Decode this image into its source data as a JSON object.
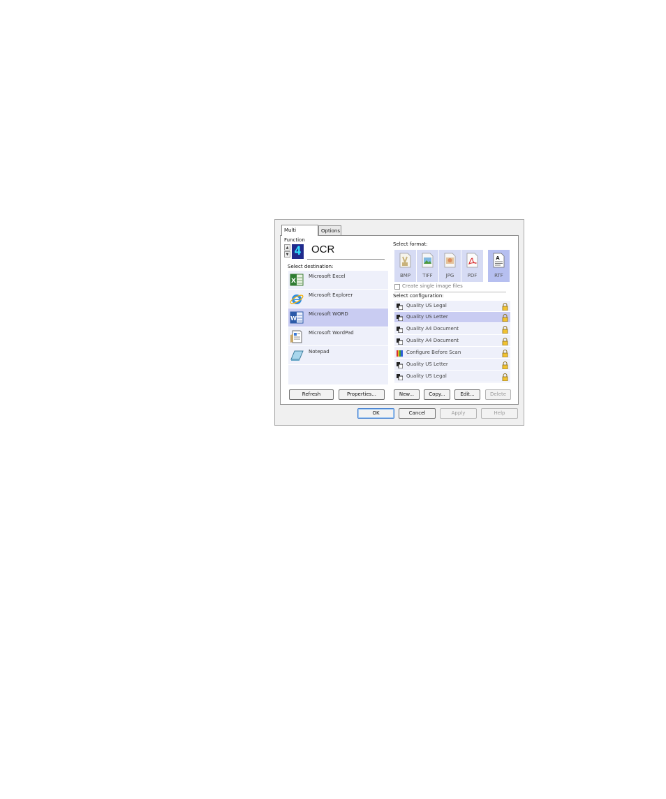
{
  "dialog": {
    "tabs": [
      {
        "label": "Multi Function",
        "active": true
      },
      {
        "label": "Options",
        "active": false
      }
    ],
    "profile": {
      "number": "4",
      "title": "OCR"
    },
    "labels": {
      "select_destination": "Select destination:",
      "select_format": "Select format:",
      "create_single": "Create single image files",
      "select_configuration": "Select configuration:"
    },
    "destinations": [
      {
        "label": "Microsoft Excel",
        "icon": "excel-icon",
        "selected": false
      },
      {
        "label": "Microsoft Explorer",
        "icon": "internet-explorer-icon",
        "selected": false
      },
      {
        "label": "Microsoft WORD",
        "icon": "word-icon",
        "selected": true
      },
      {
        "label": "Microsoft WordPad",
        "icon": "wordpad-icon",
        "selected": false
      },
      {
        "label": "Notepad",
        "icon": "notepad-icon",
        "selected": false
      }
    ],
    "formats": [
      {
        "label": "BMP",
        "icon": "bmp-file-icon",
        "selected": false
      },
      {
        "label": "TIFF",
        "icon": "tiff-file-icon",
        "selected": false
      },
      {
        "label": "JPG",
        "icon": "jpg-file-icon",
        "selected": false
      },
      {
        "label": "PDF",
        "icon": "pdf-file-icon",
        "selected": false
      },
      {
        "label": "RTF",
        "icon": "rtf-file-icon",
        "selected": true
      }
    ],
    "create_single_checked": false,
    "configurations": [
      {
        "label": "Quality US Legal",
        "selected": false
      },
      {
        "label": "Quality US Letter",
        "selected": true
      },
      {
        "label": "Quality A4 Document",
        "selected": false
      },
      {
        "label": "Quality A4 Document",
        "selected": false
      },
      {
        "label": "Configure Before Scan",
        "selected": false
      },
      {
        "label": "Quality US Letter",
        "selected": false
      },
      {
        "label": "Quality US Legal",
        "selected": false
      }
    ],
    "left_buttons": {
      "refresh": "Refresh",
      "properties": "Properties..."
    },
    "right_buttons": {
      "new": "New...",
      "copy": "Copy...",
      "edit": "Edit...",
      "delete": "Delete"
    },
    "footer_buttons": {
      "ok": "OK",
      "cancel": "Cancel",
      "apply": "Apply",
      "help": "Help"
    },
    "colors": {
      "selection": "#c9ccf2",
      "list_bg": "#eef0fa",
      "digit_bg": "#202a8c",
      "digit_fg": "#32e0ff"
    }
  }
}
